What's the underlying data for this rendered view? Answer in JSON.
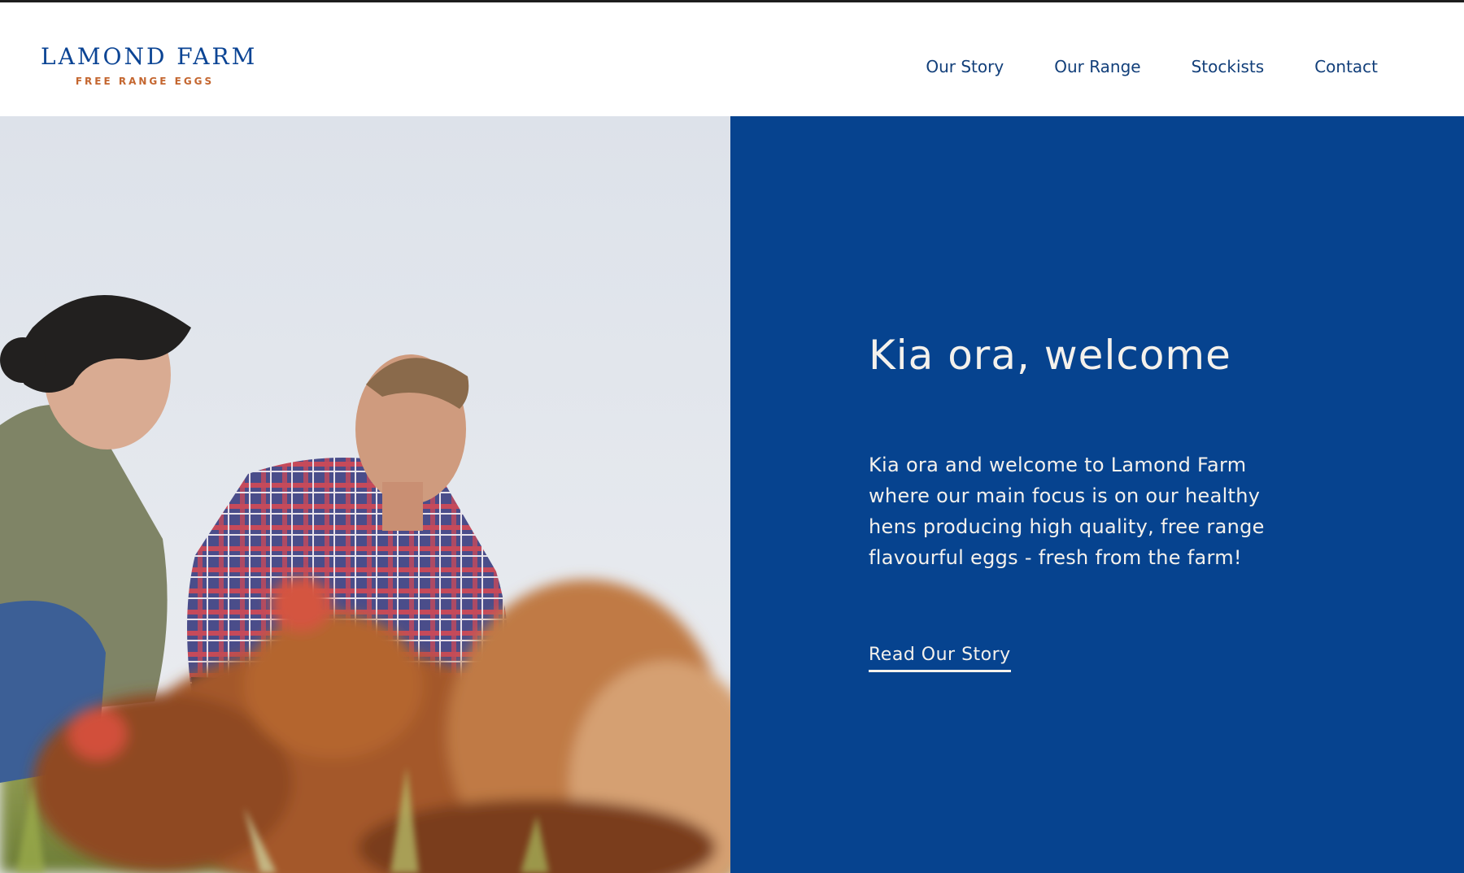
{
  "brand": {
    "name": "LAMOND FARM",
    "tagline": "FREE RANGE EGGS"
  },
  "nav": {
    "items": [
      {
        "label": "Our Story"
      },
      {
        "label": "Our Range"
      },
      {
        "label": "Stockists"
      },
      {
        "label": "Contact"
      }
    ]
  },
  "hero": {
    "heading": "Kia ora, welcome",
    "body": "Kia ora and welcome to Lamond Farm where our main focus is on our healthy hens producing high quality, free range flavourful eggs - fresh from the farm!",
    "cta_label": "Read Our Story"
  },
  "colors": {
    "brand_blue": "#06438f",
    "nav_text": "#123f7a",
    "tagline_orange": "#c4662f",
    "panel_text": "#f4f1ec"
  },
  "icons": {
    "hero_image": "farmers-with-hens-photo"
  }
}
